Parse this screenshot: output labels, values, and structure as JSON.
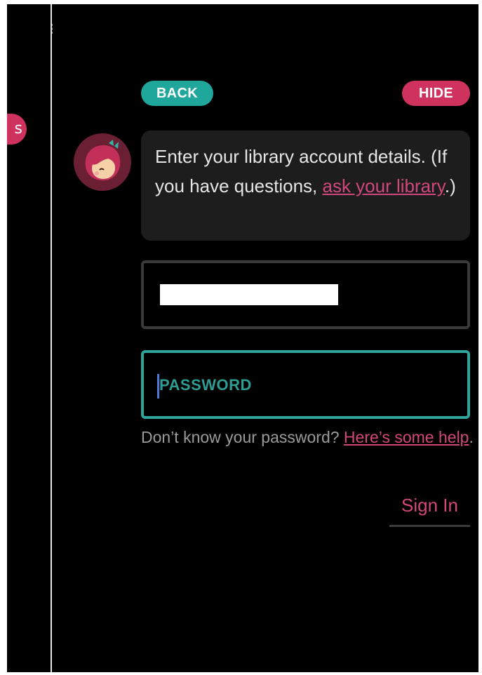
{
  "colors": {
    "teal": "#1fa79c",
    "pink": "#d0325e",
    "link_pink": "#d1477a",
    "placeholder_teal": "#2e9c93",
    "field_focus_border": "#2fa59c"
  },
  "side_pill": {
    "label": "s"
  },
  "edge_glyph": "⁝",
  "header": {
    "back_label": "BACK",
    "hide_label": "HIDE"
  },
  "avatar": {
    "icon": "libby-avatar-icon"
  },
  "message": {
    "text_before": "Enter your library account details. (If you have questions, ",
    "link_text": "ask your library",
    "text_after": ".)"
  },
  "username_field": {
    "value_redacted": true
  },
  "password_field": {
    "placeholder": "PASSWORD"
  },
  "help": {
    "text_before": "Don’t know your password? ",
    "link_text": "Here’s some help",
    "text_after": "."
  },
  "signin": {
    "label": "Sign In"
  }
}
